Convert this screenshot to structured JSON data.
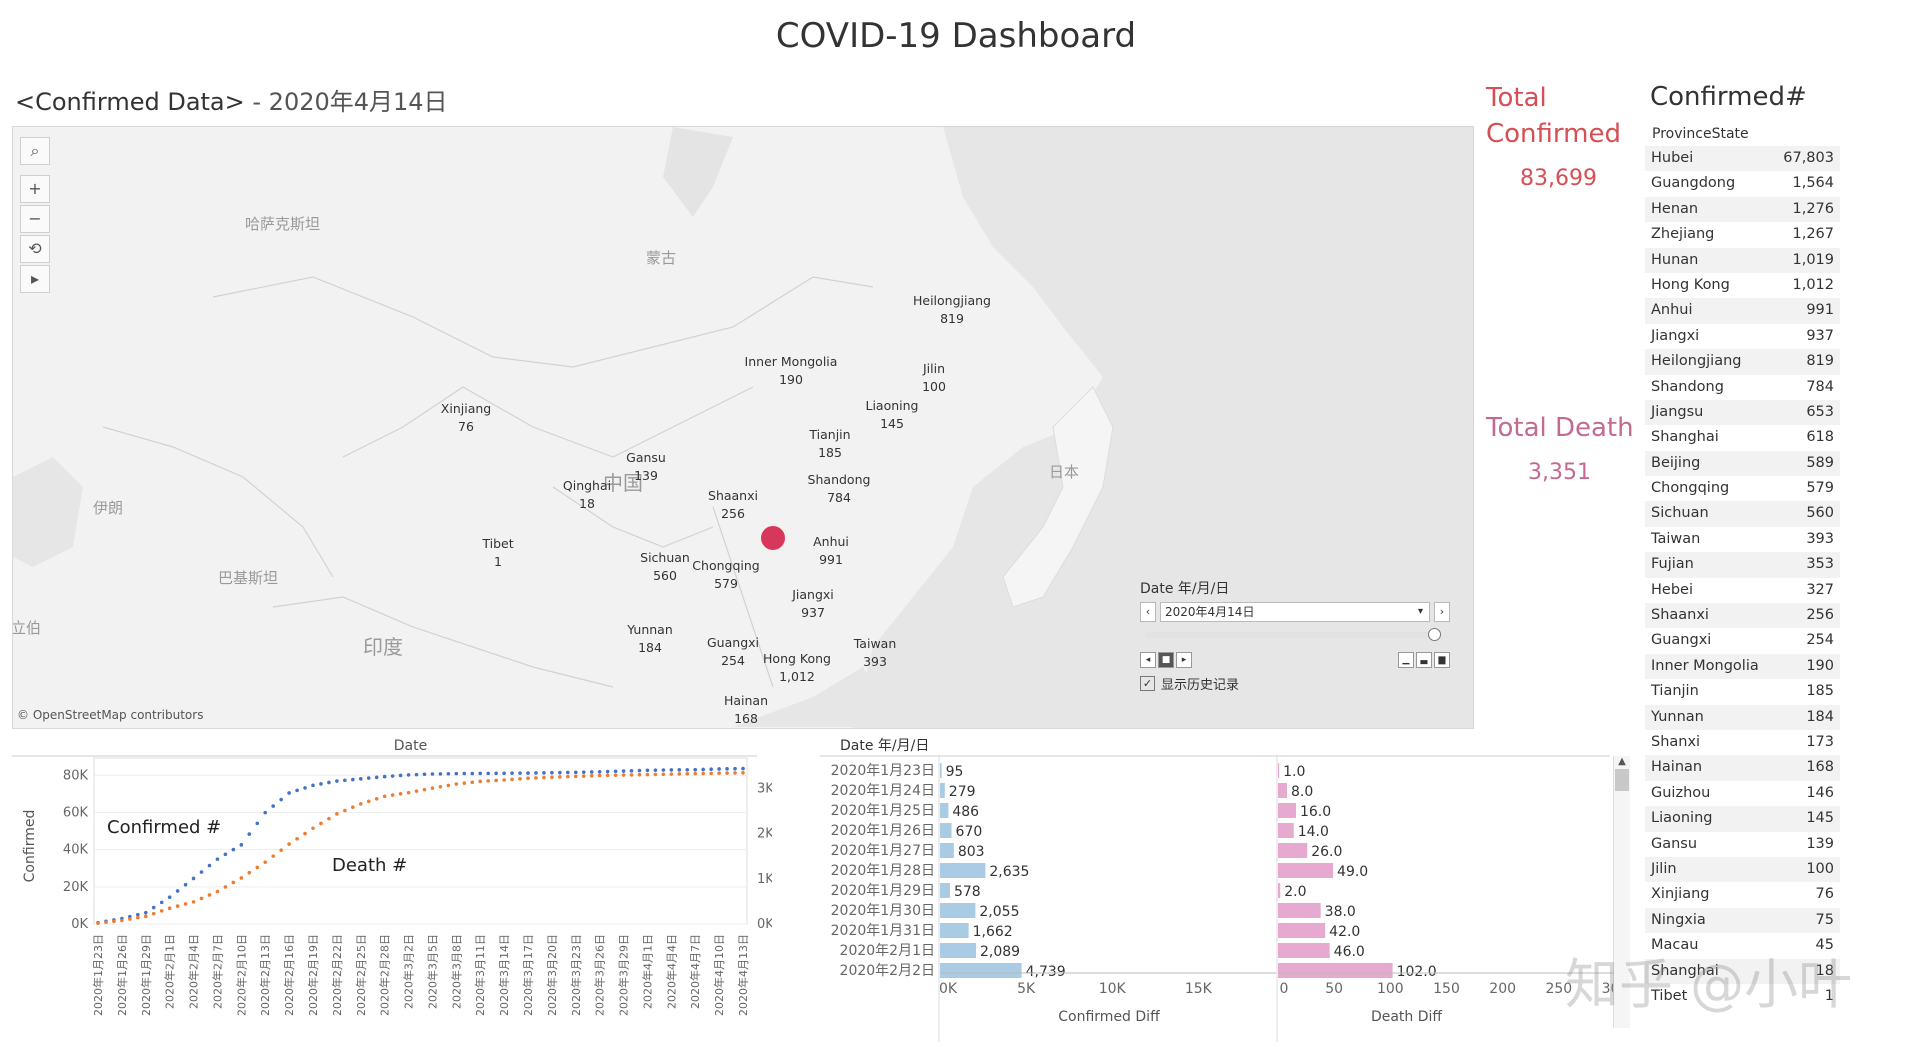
{
  "title": "COVID-19 Dashboard",
  "subtitle": {
    "sheet": "<Confirmed Data>",
    "sep": " - ",
    "date": "2020年4月14日"
  },
  "map": {
    "attribution": "© OpenStreetMap contributors",
    "tools": {
      "search": "⌕",
      "zoom_in": "+",
      "zoom_out": "−",
      "reset": "⟲",
      "play": "▸"
    },
    "geo_labels": [
      "哈萨克斯坦",
      "蒙古",
      "中国",
      "日本",
      "伊朗",
      "巴基斯坦",
      "印度",
      "立伯"
    ],
    "provinces": [
      {
        "name": "Heilongjiang",
        "value": "819"
      },
      {
        "name": "Inner Mongolia",
        "value": "190"
      },
      {
        "name": "Jilin",
        "value": "100"
      },
      {
        "name": "Liaoning",
        "value": "145"
      },
      {
        "name": "Xinjiang",
        "value": "76"
      },
      {
        "name": "Tianjin",
        "value": "185"
      },
      {
        "name": "Gansu",
        "value": "139"
      },
      {
        "name": "Shandong",
        "value": "784"
      },
      {
        "name": "Qinghai",
        "value": "18"
      },
      {
        "name": "Shaanxi",
        "value": "256"
      },
      {
        "name": "Tibet",
        "value": "1"
      },
      {
        "name": "Anhui",
        "value": "991"
      },
      {
        "name": "Sichuan",
        "value": "560"
      },
      {
        "name": "Chongqing",
        "value": "579"
      },
      {
        "name": "Jiangxi",
        "value": "937"
      },
      {
        "name": "Yunnan",
        "value": "184"
      },
      {
        "name": "Guangxi",
        "value": "254"
      },
      {
        "name": "Taiwan",
        "value": "393"
      },
      {
        "name": "Hong Kong",
        "value": "1,012"
      },
      {
        "name": "Hainan",
        "value": "168"
      }
    ],
    "highlight_color": "#d6375a"
  },
  "date_filter": {
    "label": "Date 年/月/日",
    "value": "2020年4月14日",
    "show_history_label": "显示历史记录",
    "show_history_checked": true
  },
  "totals": {
    "confirmed_label": "Total Confirmed",
    "confirmed_value": "83,699",
    "death_label": "Total Death",
    "death_value": "3,351"
  },
  "table": {
    "title": "Confirmed#",
    "header": "ProvinceState",
    "rows": [
      {
        "name": "Hubei",
        "value": "67,803"
      },
      {
        "name": "Guangdong",
        "value": "1,564"
      },
      {
        "name": "Henan",
        "value": "1,276"
      },
      {
        "name": "Zhejiang",
        "value": "1,267"
      },
      {
        "name": "Hunan",
        "value": "1,019"
      },
      {
        "name": "Hong Kong",
        "value": "1,012"
      },
      {
        "name": "Anhui",
        "value": "991"
      },
      {
        "name": "Jiangxi",
        "value": "937"
      },
      {
        "name": "Heilongjiang",
        "value": "819"
      },
      {
        "name": "Shandong",
        "value": "784"
      },
      {
        "name": "Jiangsu",
        "value": "653"
      },
      {
        "name": "Shanghai",
        "value": "618"
      },
      {
        "name": "Beijing",
        "value": "589"
      },
      {
        "name": "Chongqing",
        "value": "579"
      },
      {
        "name": "Sichuan",
        "value": "560"
      },
      {
        "name": "Taiwan",
        "value": "393"
      },
      {
        "name": "Fujian",
        "value": "353"
      },
      {
        "name": "Hebei",
        "value": "327"
      },
      {
        "name": "Shaanxi",
        "value": "256"
      },
      {
        "name": "Guangxi",
        "value": "254"
      },
      {
        "name": "Inner Mongolia",
        "value": "190"
      },
      {
        "name": "Tianjin",
        "value": "185"
      },
      {
        "name": "Yunnan",
        "value": "184"
      },
      {
        "name": "Shanxi",
        "value": "173"
      },
      {
        "name": "Hainan",
        "value": "168"
      },
      {
        "name": "Guizhou",
        "value": "146"
      },
      {
        "name": "Liaoning",
        "value": "145"
      },
      {
        "name": "Gansu",
        "value": "139"
      },
      {
        "name": "Jilin",
        "value": "100"
      },
      {
        "name": "Xinjiang",
        "value": "76"
      },
      {
        "name": "Ningxia",
        "value": "75"
      },
      {
        "name": "Macau",
        "value": "45"
      },
      {
        "name": "Shanghai",
        "value": "18"
      },
      {
        "name": "Tibet",
        "value": "1"
      }
    ]
  },
  "watermark": "知乎 @小叶",
  "chart_data": [
    {
      "type": "line",
      "title": "Date",
      "ylabel": "Confirmed",
      "y2label": "Death",
      "ylim": [
        0,
        85000
      ],
      "y2lim": [
        0,
        3500
      ],
      "yticks": [
        "0K",
        "20K",
        "40K",
        "60K",
        "80K"
      ],
      "y2ticks": [
        "0K",
        "1K",
        "2K",
        "3K"
      ],
      "annotations": [
        "Confirmed #",
        "Death #"
      ],
      "x": [
        "2020年1月23日",
        "2020年1月26日",
        "2020年1月29日",
        "2020年2月1日",
        "2020年2月4日",
        "2020年2月7日",
        "2020年2月10日",
        "2020年2月13日",
        "2020年2月16日",
        "2020年2月19日",
        "2020年2月22日",
        "2020年2月25日",
        "2020年2月28日",
        "2020年3月2日",
        "2020年3月5日",
        "2020年3月8日",
        "2020年3月11日",
        "2020年3月14日",
        "2020年3月17日",
        "2020年3月20日",
        "2020年3月23日",
        "2020年3月26日",
        "2020年3月29日",
        "2020年4月1日",
        "2020年4月4日",
        "2020年4月7日",
        "2020年4月10日",
        "2020年4月13日"
      ],
      "series": [
        {
          "name": "Confirmed #",
          "color": "#4472c4",
          "values": [
            700,
            2900,
            6100,
            14400,
            24500,
            34900,
            42600,
            59900,
            70500,
            74600,
            76900,
            78100,
            79300,
            80200,
            80700,
            80900,
            81000,
            81100,
            81200,
            81400,
            81600,
            81900,
            82300,
            82700,
            82900,
            83000,
            83400,
            83600
          ]
        },
        {
          "name": "Death #",
          "color": "#ed7d31",
          "values": [
            18,
            80,
            170,
            350,
            490,
            720,
            1020,
            1370,
            1770,
            2120,
            2440,
            2660,
            2830,
            2910,
            3010,
            3100,
            3160,
            3190,
            3230,
            3250,
            3270,
            3290,
            3300,
            3310,
            3320,
            3330,
            3340,
            3350
          ]
        }
      ]
    },
    {
      "type": "bar",
      "title": "Date 年/月/日",
      "xlabel": "Confirmed Diff",
      "xticks": [
        "0K",
        "5K",
        "10K",
        "15K"
      ],
      "xlim": [
        0,
        18000
      ],
      "categories": [
        "2020年1月23日",
        "2020年1月24日",
        "2020年1月25日",
        "2020年1月26日",
        "2020年1月27日",
        "2020年1月28日",
        "2020年1月29日",
        "2020年1月30日",
        "2020年1月31日",
        "2020年2月1日",
        "2020年2月2日"
      ],
      "values": [
        95,
        279,
        486,
        670,
        803,
        2635,
        578,
        2055,
        1662,
        2089,
        4739
      ],
      "labels": [
        "95",
        "279",
        "486",
        "670",
        "803",
        "2,635",
        "578",
        "2,055",
        "1,662",
        "2,089",
        "4,739"
      ]
    },
    {
      "type": "bar",
      "xlabel": "Death Diff",
      "xticks": [
        "0",
        "50",
        "100",
        "150",
        "200",
        "250",
        "300"
      ],
      "xlim": [
        0,
        300
      ],
      "categories": [
        "2020年1月23日",
        "2020年1月24日",
        "2020年1月25日",
        "2020年1月26日",
        "2020年1月27日",
        "2020年1月28日",
        "2020年1月29日",
        "2020年1月30日",
        "2020年1月31日",
        "2020年2月1日",
        "2020年2月2日"
      ],
      "values": [
        1,
        8,
        16,
        14,
        26,
        49,
        2,
        38,
        42,
        46,
        102
      ],
      "labels": [
        "1.0",
        "8.0",
        "16.0",
        "14.0",
        "26.0",
        "49.0",
        "2.0",
        "38.0",
        "42.0",
        "46.0",
        "102.0"
      ]
    }
  ]
}
